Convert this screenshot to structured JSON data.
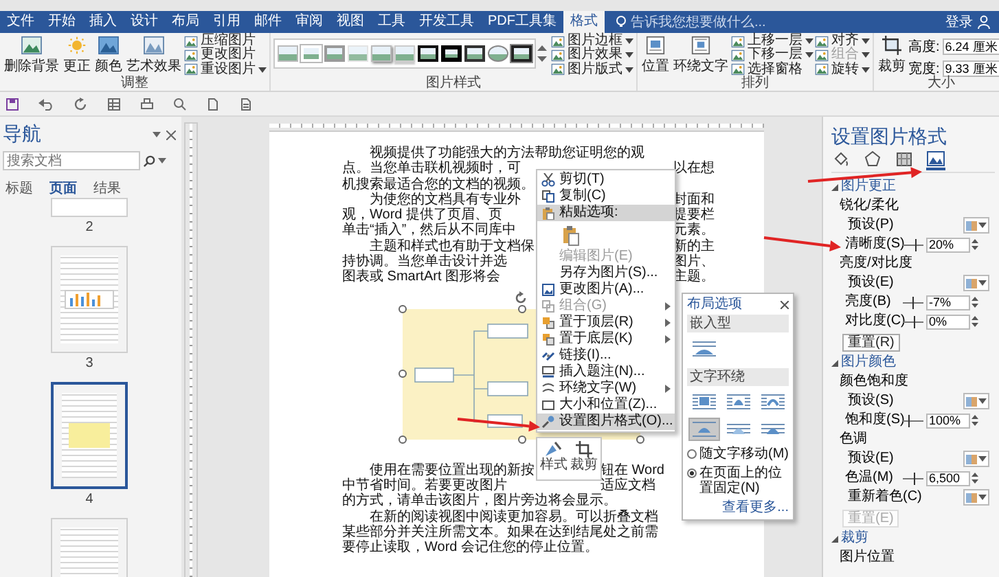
{
  "tabs": [
    {
      "label": "文件",
      "selected": false
    },
    {
      "label": "开始",
      "selected": false
    },
    {
      "label": "插入",
      "selected": false
    },
    {
      "label": "设计",
      "selected": false
    },
    {
      "label": "布局",
      "selected": false
    },
    {
      "label": "引用",
      "selected": false
    },
    {
      "label": "邮件",
      "selected": false
    },
    {
      "label": "审阅",
      "selected": false
    },
    {
      "label": "视图",
      "selected": false
    },
    {
      "label": "工具",
      "selected": false
    },
    {
      "label": "开发工具",
      "selected": false
    },
    {
      "label": "PDF工具集",
      "selected": false
    },
    {
      "label": "格式",
      "selected": true
    }
  ],
  "tell_me": {
    "placeholder": "告诉我您想要做什么..."
  },
  "account": {
    "label": "登录"
  },
  "ribbon": {
    "groups": [
      {
        "label": "调整",
        "controls": [
          {
            "kind": "large",
            "label": "删除背景"
          },
          {
            "kind": "large",
            "label": "更正"
          },
          {
            "kind": "large",
            "label": "颜色"
          },
          {
            "kind": "large",
            "label": "艺术效果"
          },
          {
            "kind": "stack",
            "items": [
              {
                "label": "压缩图片",
                "disabled": false,
                "menu": false
              },
              {
                "label": "更改图片",
                "disabled": false,
                "menu": false
              },
              {
                "label": "重设图片",
                "disabled": false,
                "menu": true
              }
            ]
          }
        ]
      },
      {
        "label": "图片样式",
        "controls": [
          {
            "kind": "gallery",
            "items": [
              {
                "kind": "simple"
              },
              {
                "kind": "white"
              },
              {
                "kind": "grey"
              },
              {
                "kind": "soft"
              },
              {
                "kind": "shadow"
              },
              {
                "kind": "reflect"
              },
              {
                "kind": "black"
              },
              {
                "kind": "double"
              },
              {
                "kind": "thin"
              },
              {
                "kind": "oval"
              },
              {
                "kind": "frame"
              }
            ]
          },
          {
            "kind": "stack",
            "items": [
              {
                "label": "图片边框",
                "disabled": false,
                "menu": true
              },
              {
                "label": "图片效果",
                "disabled": false,
                "menu": true
              },
              {
                "label": "图片版式",
                "disabled": false,
                "menu": true
              }
            ]
          }
        ]
      },
      {
        "label": "排列",
        "controls": [
          {
            "kind": "large",
            "label": "位置"
          },
          {
            "kind": "large",
            "label": "环绕文字"
          },
          {
            "kind": "stack",
            "items": [
              {
                "label": "上移一层",
                "disabled": false,
                "menu": true
              },
              {
                "label": "下移一层",
                "disabled": false,
                "menu": true
              },
              {
                "label": "选择窗格",
                "disabled": false,
                "menu": false
              }
            ]
          },
          {
            "kind": "stack",
            "items": [
              {
                "label": "对齐",
                "disabled": false,
                "menu": true
              },
              {
                "label": "组合",
                "disabled": true,
                "menu": true
              },
              {
                "label": "旋转",
                "disabled": false,
                "menu": true
              }
            ]
          }
        ]
      },
      {
        "label": "大小",
        "controls": [
          {
            "kind": "large",
            "label": "裁剪"
          },
          {
            "kind": "size",
            "items": [
              {
                "label": "高度:",
                "value": "6.24 厘米"
              },
              {
                "label": "宽度:",
                "value": "9.33 厘米"
              }
            ]
          }
        ]
      }
    ]
  },
  "navigation": {
    "title": "导航",
    "search": {
      "placeholder": "搜索文档"
    },
    "tabs": [
      {
        "label": "标题",
        "selected": false
      },
      {
        "label": "页面",
        "selected": true
      },
      {
        "label": "结果",
        "selected": false
      }
    ],
    "pages": [
      {
        "number": "2",
        "kind": "blank",
        "selected": false
      },
      {
        "number": "3",
        "kind": "chart",
        "selected": false
      },
      {
        "number": "4",
        "kind": "image",
        "selected": true
      },
      {
        "kind": "title",
        "selected": false
      }
    ]
  },
  "document": {
    "upper_lines": [
      {
        "text": "视频提供了功能强大的方法帮助您证明您的观",
        "indent": true
      },
      {
        "text": "点。当您单击联机视频时，可",
        "after": "以在想",
        "indent": false
      },
      {
        "text": "机搜索最适合您的文档的视频。",
        "indent": false
      },
      {
        "text": "为使您的文档具有专业外",
        "after": "封面和",
        "indent": true
      },
      {
        "text": "观，Word 提供了页眉、页",
        "after": "提要栏",
        "indent": false
      },
      {
        "text": "单击“插入”，然后从不同库中",
        "after": "元素。",
        "indent": false
      },
      {
        "text": "主题和样式也有助于文档保",
        "after": "新的主",
        "indent": true
      },
      {
        "text": "持协调。当您单击设计并选",
        "after": "图片、",
        "indent": false
      },
      {
        "text": "图表或 SmartArt 图形将会",
        "after": "主题。",
        "indent": false
      }
    ],
    "lower_lines": [
      {
        "text": "使用在需要位置出现的新按",
        "after": "钮在 Word",
        "indent": true
      },
      {
        "text": "中节省时间。若要更改图片",
        "after": "适应文档",
        "indent": false
      },
      {
        "text": "的方式，请单击该图片，图片旁边将会显示。",
        "indent": false
      },
      {
        "text": "在新的阅读视图中阅读更加容易。可以折叠文档",
        "indent": true
      },
      {
        "text": "某些部分并关注所需文本。如果在达到结尾处之前需",
        "indent": false
      },
      {
        "text": "要停止读取，Word 会记住您的停止位置。",
        "indent": false
      }
    ]
  },
  "context_menu": {
    "items": [
      {
        "kind": "item",
        "label": "剪切(T)",
        "disabled": false,
        "selected": false,
        "submenu": false
      },
      {
        "kind": "item",
        "label": "复制(C)",
        "disabled": false,
        "selected": false,
        "submenu": false
      },
      {
        "kind": "item",
        "label": "粘贴选项:",
        "disabled": false,
        "selected": true,
        "submenu": false
      },
      {
        "kind": "paste"
      },
      {
        "kind": "item",
        "label": "编辑图片(E)",
        "disabled": true,
        "selected": false,
        "submenu": false
      },
      {
        "kind": "item",
        "label": "另存为图片(S)...",
        "disabled": false,
        "selected": false,
        "submenu": false
      },
      {
        "kind": "item",
        "label": "更改图片(A)...",
        "disabled": false,
        "selected": false,
        "submenu": false
      },
      {
        "kind": "item",
        "label": "组合(G)",
        "disabled": true,
        "selected": false,
        "submenu": true
      },
      {
        "kind": "item",
        "label": "置于顶层(R)",
        "disabled": false,
        "selected": false,
        "submenu": true
      },
      {
        "kind": "item",
        "label": "置于底层(K)",
        "disabled": false,
        "selected": false,
        "submenu": true
      },
      {
        "kind": "item",
        "label": "链接(I)...",
        "disabled": false,
        "selected": false,
        "submenu": false
      },
      {
        "kind": "item",
        "label": "插入题注(N)...",
        "disabled": false,
        "selected": false,
        "submenu": false
      },
      {
        "kind": "item",
        "label": "环绕文字(W)",
        "disabled": false,
        "selected": false,
        "submenu": true
      },
      {
        "kind": "item",
        "label": "大小和位置(Z)...",
        "disabled": false,
        "selected": false,
        "submenu": false
      },
      {
        "kind": "item",
        "label": "设置图片格式(O)...",
        "disabled": false,
        "selected": true,
        "submenu": false
      }
    ]
  },
  "mini_toolbar": {
    "buttons": [
      {
        "kind": "style",
        "label": "样式"
      },
      {
        "kind": "crop",
        "label": "裁剪"
      }
    ]
  },
  "layout_options": {
    "title": "布局选项",
    "inline_heading": "嵌入型",
    "inline_selected": false,
    "wrap_heading": "文字环绕",
    "wrap_options": [
      {
        "kind": "square",
        "selected": false
      },
      {
        "kind": "tight",
        "selected": false
      },
      {
        "kind": "through",
        "selected": false
      },
      {
        "kind": "topbottom",
        "selected": true
      },
      {
        "kind": "behind",
        "selected": false
      },
      {
        "kind": "front",
        "selected": false
      }
    ],
    "radios": [
      {
        "label": "随文字移动(M)",
        "selected": false
      },
      {
        "label": "在页面上的位置固定(N)",
        "selected": true
      }
    ],
    "more_link": "查看更多..."
  },
  "format_pane": {
    "title": "设置图片格式",
    "tabs": [
      {
        "kind": "fill",
        "selected": false
      },
      {
        "kind": "effects",
        "selected": false
      },
      {
        "kind": "size",
        "selected": false
      },
      {
        "kind": "picture",
        "selected": true
      }
    ],
    "sections": [
      {
        "title": "图片更正",
        "expanded": true,
        "rows": [
          {
            "kind": "label",
            "label": "锐化/柔化"
          },
          {
            "kind": "preset",
            "label": "预设(P)"
          },
          {
            "kind": "slider",
            "label": "清晰度(S)",
            "level": 0.6,
            "value": "20%"
          },
          {
            "kind": "label",
            "label": "亮度/对比度"
          },
          {
            "kind": "preset",
            "label": "预设(E)"
          },
          {
            "kind": "slider",
            "label": "亮度(B)",
            "level": 0.47,
            "value": "-7%"
          },
          {
            "kind": "slider",
            "label": "对比度(C)",
            "level": 0.5,
            "value": "0%"
          },
          {
            "kind": "button",
            "label": "重置(R)",
            "disabled": false
          }
        ]
      },
      {
        "title": "图片颜色",
        "expanded": true,
        "rows": [
          {
            "kind": "label",
            "label": "颜色饱和度"
          },
          {
            "kind": "preset",
            "label": "预设(S)"
          },
          {
            "kind": "slider",
            "label": "饱和度(S)",
            "level": 0.25,
            "value": "100%"
          },
          {
            "kind": "label",
            "label": "色调"
          },
          {
            "kind": "preset",
            "label": "预设(E)"
          },
          {
            "kind": "slider",
            "label": "色温(M)",
            "level": 0.5,
            "value": "6,500"
          },
          {
            "kind": "preset",
            "label": "重新着色(C)"
          },
          {
            "kind": "button",
            "label": "重置(E)",
            "disabled": true
          }
        ]
      },
      {
        "title": "裁剪",
        "expanded": true,
        "rows": [
          {
            "kind": "label",
            "label": "图片位置"
          }
        ]
      }
    ]
  }
}
